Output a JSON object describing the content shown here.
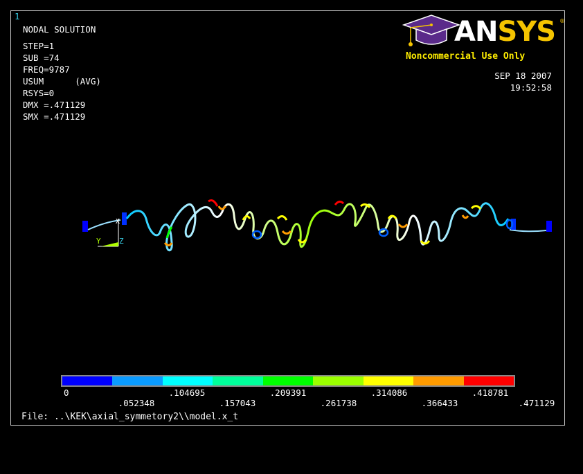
{
  "window_number": "1",
  "info": {
    "title": "NODAL SOLUTION",
    "lines": [
      "STEP=1",
      "SUB =74",
      "FREQ=9787",
      "USUM      (AVG)",
      "RSYS=0",
      "DMX =.471129",
      "SMX =.471129"
    ]
  },
  "logo": {
    "brand_an": "AN",
    "brand_sys": "SYS",
    "registered": "®",
    "tagline": "Noncommercial Use Only"
  },
  "date": {
    "date": "SEP 18 2007",
    "time": "19:52:58"
  },
  "triad": {
    "y_label": "Y",
    "z_label": "Z",
    "x_label": "X"
  },
  "legend": {
    "colors": [
      "#0000ff",
      "#0a9bff",
      "#00ffff",
      "#00ff9b",
      "#00ff00",
      "#9bff00",
      "#ffff00",
      "#ff9b00",
      "#ff0000"
    ],
    "top_labels": [
      "0",
      ".104695",
      ".209391",
      ".314086",
      ".418781"
    ],
    "bottom_labels": [
      ".052348",
      ".157043",
      ".261738",
      ".366433",
      ".471129"
    ]
  },
  "file": {
    "text": "File: ..\\KEK\\axial_symmetory2\\\\model.x_t"
  }
}
